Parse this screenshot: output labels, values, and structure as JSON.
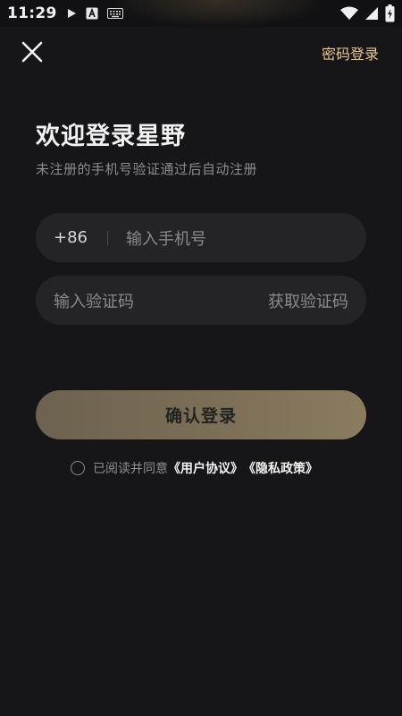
{
  "status_bar": {
    "time": "11:29",
    "icons": [
      "play-icon",
      "app-a-icon",
      "keyboard-icon",
      "wifi-icon",
      "signal-icon",
      "battery-charging-icon"
    ]
  },
  "header": {
    "close_icon": "close-icon",
    "password_login": "密码登录"
  },
  "main": {
    "title": "欢迎登录星野",
    "subtitle": "未注册的手机号验证通过后自动注册",
    "phone": {
      "prefix": "+86",
      "placeholder": "输入手机号"
    },
    "code": {
      "placeholder": "输入验证码",
      "get_code": "获取验证码"
    },
    "login_button": "确认登录",
    "agreement": {
      "text": "已阅读并同意",
      "user_agreement": "《用户协议》",
      "privacy_policy": "《隐私政策》"
    }
  },
  "colors": {
    "background": "#161618",
    "accent_gold": "#e4c88f",
    "field_bg": "#242426",
    "button_bg": "#7c6f57"
  }
}
